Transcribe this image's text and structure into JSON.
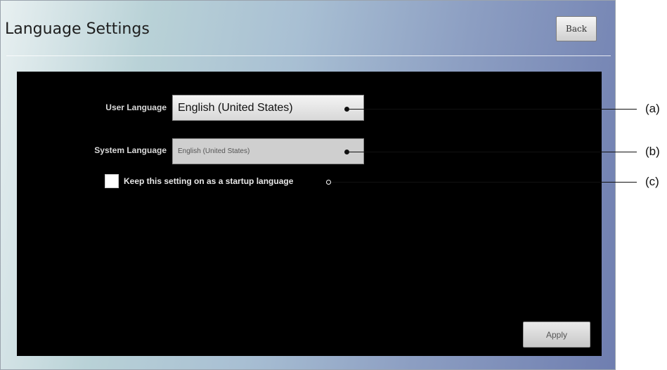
{
  "window": {
    "title": "Language Settings"
  },
  "buttons": {
    "back": "Back",
    "apply": "Apply"
  },
  "user_language": {
    "label": "User Language",
    "value": "English (United States)"
  },
  "system_language": {
    "label": "System Language",
    "value": "English (United States)"
  },
  "startup_option": {
    "label": "Keep this setting on as a startup language",
    "checked": false
  },
  "callouts": {
    "a": "(a)",
    "b": "(b)",
    "c": "(c)"
  }
}
